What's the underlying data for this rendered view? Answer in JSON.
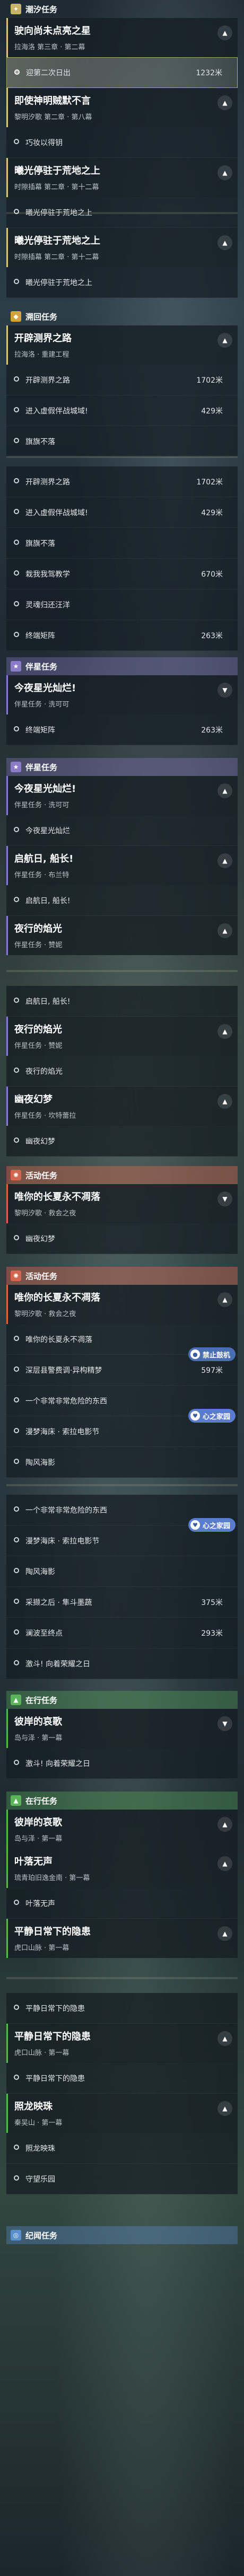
{
  "headers": {
    "chao": "潮汐任务",
    "yuan": "溯回任务",
    "ban": "伴星任务",
    "huo": "活动任务",
    "zai": "在行任务",
    "ji": "纪闻任务"
  },
  "cards": {
    "c1": {
      "t": "驶向尚未点亮之星",
      "s": "拉海洛 第三章 · 第二幕"
    },
    "c2": {
      "t": "即使神明贼默不言",
      "s": "黎明汐歌 第二章 · 第八幕"
    },
    "c3": {
      "t": "曦光停驻于荒地之上",
      "s": "时隙插幕 第二章 · 第十二幕"
    },
    "c4": {
      "t": "曦光停驻于荒地之上",
      "s": "时隙插幕 第二章 · 第十二幕"
    },
    "c5": {
      "t": "开辟测界之路",
      "s": "拉海洛 · 重建工程"
    },
    "c6": {
      "t": "今夜星光灿烂!",
      "s": "伴星任务 · 洗可可"
    },
    "c7": {
      "t": "今夜星光灿烂!",
      "s": "伴星任务 · 洗可可"
    },
    "c8": {
      "t": "启航日, 船长!",
      "s": "伴星任务 · 布兰特"
    },
    "c9": {
      "t": "夜行的焰光",
      "s": "伴星任务 · 赞妮"
    },
    "c10": {
      "t": "夜行的焰光",
      "s": "伴星任务 · 赞妮"
    },
    "c11": {
      "t": "幽夜幻梦",
      "s": "伴星任务 · 坎特蕾拉"
    },
    "c12": {
      "t": "唯你的长夏永不凋落",
      "s": "黎明汐歌 · 救会之夜"
    },
    "c13": {
      "t": "唯你的长夏永不凋落",
      "s": "黎明汐歌 · 救会之夜"
    },
    "c14": {
      "t": "彼岸的哀歌",
      "s": "岛与泽 · 第一幕"
    },
    "c15": {
      "t": "彼岸的哀歌",
      "s": "岛与泽 · 第一幕"
    },
    "c16": {
      "t": "叶落无声",
      "s": "琉青珀旧逸金南 · 第一幕"
    },
    "c17": {
      "t": "平静日常下的隐患",
      "s": "虎口山脉 · 第一幕"
    },
    "c18": {
      "t": "平静日常下的隐患",
      "s": "虎口山脉 · 第一幕"
    },
    "c19": {
      "t": "照龙映珠",
      "s": "秦吴山 · 第一幕"
    }
  },
  "rows": {
    "r1": {
      "l": "迎第二次日出",
      "d": "1232米"
    },
    "r2": {
      "l": "巧妆以得钥",
      "d": ""
    },
    "r3": {
      "l": "曦光停驻于荒地之上",
      "d": ""
    },
    "r4": {
      "l": "曦光停驻于荒地之上",
      "d": ""
    },
    "r5": {
      "l": "开辟测界之路",
      "d": "1702米"
    },
    "r6": {
      "l": "进入虚假伴战城域!",
      "d": "429米"
    },
    "r7": {
      "l": "旗旗不落",
      "d": ""
    },
    "r8": {
      "l": "开辟测界之路",
      "d": "1702米"
    },
    "r9": {
      "l": "进入虚假伴战城域!",
      "d": "429米"
    },
    "r10": {
      "l": "旗旗不落",
      "d": ""
    },
    "r11": {
      "l": "栽我我驾教学",
      "d": "670米"
    },
    "r12": {
      "l": "灵魂归还汪洋",
      "d": ""
    },
    "r13": {
      "l": "终端矩阵",
      "d": "263米"
    },
    "r14": {
      "l": "终端矩阵",
      "d": "263米"
    },
    "r15": {
      "l": "今夜星光灿烂",
      "d": ""
    },
    "r16": {
      "l": "启航日, 船长!",
      "d": ""
    },
    "r17": {
      "l": "启航日, 船长!",
      "d": ""
    },
    "r18": {
      "l": "夜行的焰光",
      "d": ""
    },
    "r19": {
      "l": "幽夜幻梦",
      "d": ""
    },
    "r20": {
      "l": "幽夜幻梦",
      "d": ""
    },
    "r21": {
      "l": "唯你的长夏永不凋落",
      "d": ""
    },
    "r22": {
      "l": "深层县警费调·异构精梦",
      "d": "597米"
    },
    "r23": {
      "l": "一个非常非常危险的东西",
      "d": ""
    },
    "r24": {
      "l": "漫梦海床 · 索拉电影节",
      "d": ""
    },
    "r25": {
      "l": "陶风海影",
      "d": ""
    },
    "r26": {
      "l": "一个非常非常危险的东西",
      "d": ""
    },
    "r27": {
      "l": "漫梦海床 · 索拉电影节",
      "d": ""
    },
    "r28": {
      "l": "陶风海影",
      "d": ""
    },
    "r29": {
      "l": "采撷之后 · 隼斗墨蔬",
      "d": "375米"
    },
    "r30": {
      "l": "澜波至终点",
      "d": "293米"
    },
    "r31": {
      "l": "激斗! 向着荣耀之日",
      "d": ""
    },
    "r32": {
      "l": "激斗! 向着荣耀之日",
      "d": ""
    },
    "r33": {
      "l": "叶落无声",
      "d": ""
    },
    "r34": {
      "l": "平静日常下的隐患",
      "d": ""
    },
    "r35": {
      "l": "照龙映珠",
      "d": ""
    },
    "r36": {
      "l": "守望乐园",
      "d": ""
    }
  },
  "chips": {
    "k1": "禁止鼓机",
    "k2": "心之家园",
    "k3": "心之家园"
  },
  "colors": {
    "chao": "#c8b46a",
    "yuan": "#d2a23c",
    "ban": "#8a7cc8",
    "huo": "#d0674e",
    "zai": "#5bb35a",
    "ji": "#5a8fd0"
  }
}
